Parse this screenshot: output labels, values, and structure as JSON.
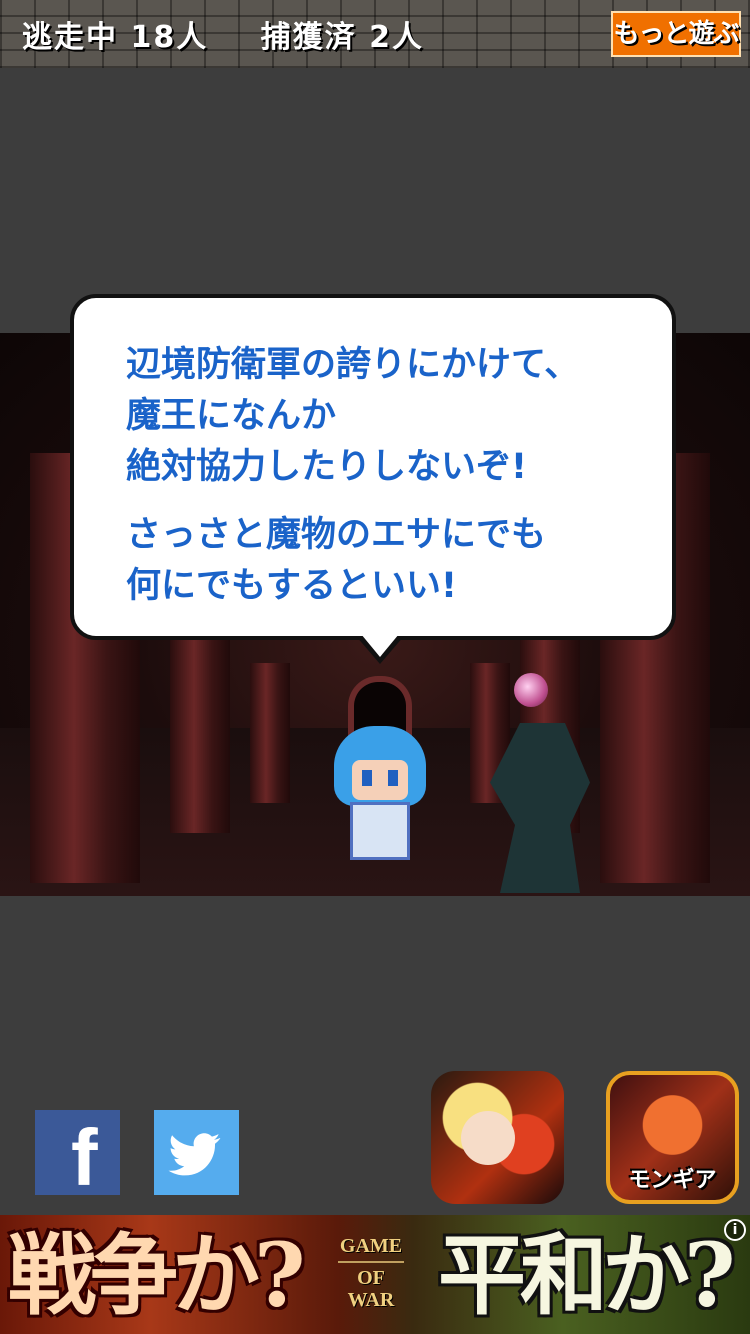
{
  "status_bar": {
    "escaping_label": "逃走中 18人",
    "captured_label": "捕獲済 2人",
    "more_games_button": "もっと遊ぶ"
  },
  "dialogue": {
    "paragraph1": [
      "辺境防衛軍の誇りにかけて、",
      "魔王になんか",
      "絶対協力したりしないぞ!"
    ],
    "paragraph2": [
      "さっさと魔物のエサにでも",
      "何にでもするといい!"
    ]
  },
  "social": {
    "facebook_icon": "facebook-icon",
    "twitter_icon": "twitter-icon"
  },
  "promo_apps": [
    {
      "name": "promo-app-1",
      "label": ""
    },
    {
      "name": "promo-app-2",
      "label": "モンギア"
    }
  ],
  "ad_banner": {
    "left_text": "戦争か?",
    "logo_line1": "GAME",
    "logo_line2": "OF",
    "logo_line3": "WAR",
    "right_text": "平和か?",
    "info_icon": "i"
  },
  "colors": {
    "dialogue_text": "#1a63c9",
    "more_button": "#f07000",
    "facebook": "#3b5998",
    "twitter": "#55acee"
  }
}
